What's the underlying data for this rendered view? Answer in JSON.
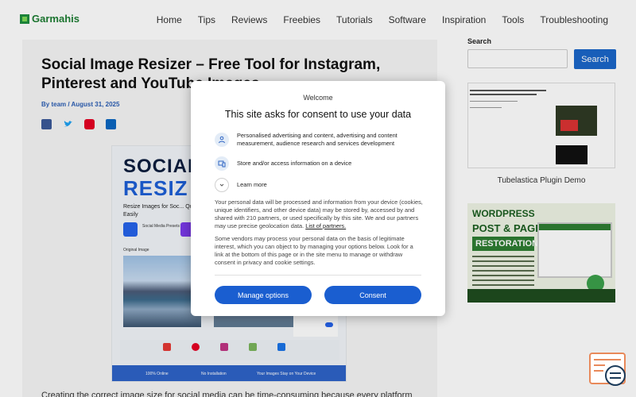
{
  "header": {
    "logo_text": "Garmahis",
    "nav": [
      "Home",
      "Tips",
      "Reviews",
      "Freebies",
      "Tutorials",
      "Software",
      "Inspiration",
      "Tools",
      "Troubleshooting"
    ]
  },
  "article": {
    "title": "Social Image Resizer – Free Tool for Instagram, Pinterest and YouTube Images",
    "byline": "By team / August 31, 2025",
    "body_start": "Creating the correct image size for social media can be time-consuming because every platform"
  },
  "featured_image": {
    "line1": "SOCIAL",
    "line2": "RESIZ",
    "subtitle": "Resize Images for Soc... Quickly and Easily",
    "preset_label": "Social Media Presets",
    "original_label": "Original Image",
    "footer": [
      "100% Online",
      "No Installation",
      "Your Images Stay on Your Device"
    ]
  },
  "sidebar": {
    "search_label": "Search",
    "search_placeholder": "",
    "search_button": "Search",
    "thumb1_caption": "Tubelastica Plugin Demo",
    "thumb2": {
      "line1": "WORDPRESS",
      "line2": "POST & PAGE",
      "line3": "RESTORATION"
    }
  },
  "consent": {
    "welcome": "Welcome",
    "title": "This site asks for consent to use your data",
    "items": [
      {
        "icon": "person-icon",
        "text": "Personalised advertising and content, advertising and content measurement, audience research and services development"
      },
      {
        "icon": "device-icon",
        "text": "Store and/or access information on a device"
      },
      {
        "icon": "chevron-down-icon",
        "text": "Learn more"
      }
    ],
    "para1": "Your personal data will be processed and information from your device (cookies, unique identifiers, and other device data) may be stored by, accessed by and shared with 210 partners, or used specifically by this site. We and our partners may use precise geolocation data.",
    "para1_link": "List of partners.",
    "para2": "Some vendors may process your personal data on the basis of legitimate interest, which you can object to by managing your options below. Look for a link at the bottom of this page or in the site menu to manage or withdraw consent in privacy and cookie settings.",
    "manage_button": "Manage options",
    "consent_button": "Consent"
  },
  "colors": {
    "accent": "#1a5ed0",
    "brand": "#1e8e3e"
  }
}
